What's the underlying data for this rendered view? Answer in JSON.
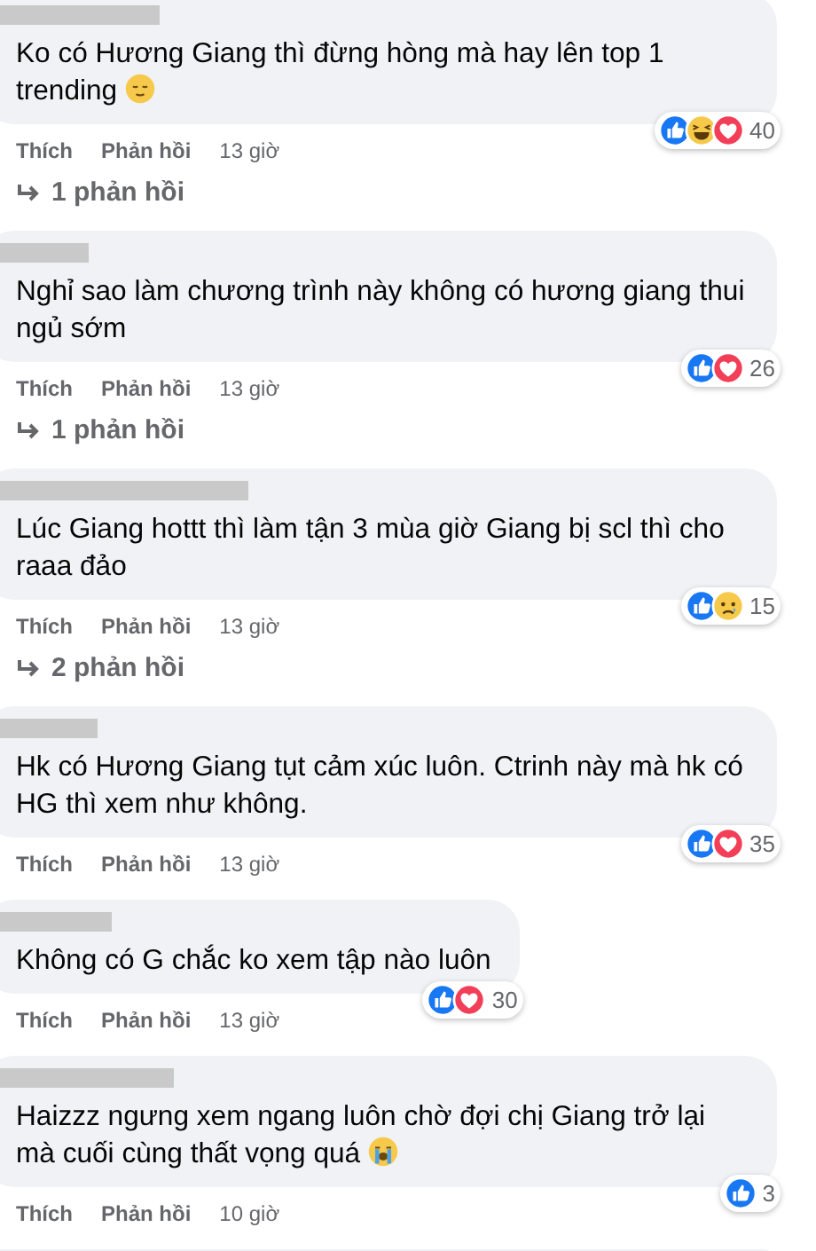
{
  "comments": [
    {
      "kind": "full",
      "text": "Ko có Hương Giang thì đừng hòng mà hay lên top 1 trending",
      "emoji": {
        "kind": "relieved"
      },
      "reactions": [
        {
          "kind": "like"
        },
        {
          "kind": "haha"
        },
        {
          "kind": "love"
        }
      ],
      "reaction_count": "40",
      "actions": [
        "Thích",
        "Phản hồi"
      ],
      "time": "13 giờ",
      "replies": "1 phản hồi"
    },
    {
      "kind": "full",
      "text": "Nghỉ sao làm chương trình này không có hương giang thui ngủ sớm",
      "reactions": [
        {
          "kind": "like"
        },
        {
          "kind": "love"
        }
      ],
      "reaction_count": "26",
      "actions": [
        "Thích",
        "Phản hồi"
      ],
      "time": "13 giờ",
      "replies": "1 phản hồi"
    },
    {
      "kind": "full",
      "text": "Lúc Giang hottt thì làm tận 3 mùa giờ Giang bị scl thì cho raaa đảo",
      "reactions": [
        {
          "kind": "like"
        },
        {
          "kind": "sad"
        }
      ],
      "reaction_count": "15",
      "actions": [
        "Thích",
        "Phản hồi"
      ],
      "time": "13 giờ",
      "replies": "2 phản hồi"
    },
    {
      "kind": "full",
      "text": "Hk có Hương Giang tụt cảm xúc luôn. Ctrinh này mà hk có HG thì xem như không.",
      "reactions": [
        {
          "kind": "like"
        },
        {
          "kind": "love"
        }
      ],
      "reaction_count": "35",
      "actions": [
        "Thích",
        "Phản hồi"
      ],
      "time": "13 giờ"
    },
    {
      "kind": "full",
      "text": "Không có G chắc ko xem tập nào luôn",
      "reactions": [
        {
          "kind": "like"
        },
        {
          "kind": "love"
        }
      ],
      "reaction_count": "30",
      "actions": [
        "Thích",
        "Phản hồi"
      ],
      "time": "13 giờ"
    },
    {
      "kind": "full",
      "text": "Haizzz ngưng xem ngang luôn chờ đợi chị Giang trở lại mà cuối cùng thất vọng quá",
      "emoji": {
        "kind": "crying"
      },
      "reactions": [
        {
          "kind": "like"
        }
      ],
      "reaction_count": "3",
      "actions": [
        "Thích",
        "Phản hồi"
      ],
      "time": "10 giờ"
    },
    {
      "kind": "partial"
    }
  ]
}
